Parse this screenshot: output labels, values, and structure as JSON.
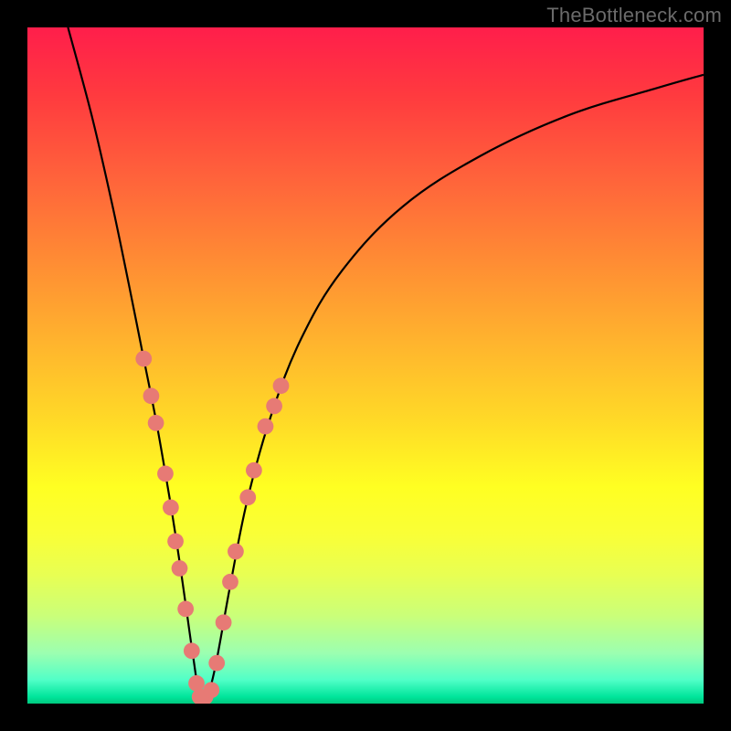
{
  "watermark": "TheBottleneck.com",
  "chart_data": {
    "type": "line",
    "title": "",
    "xlabel": "",
    "ylabel": "",
    "xlim": [
      0,
      1
    ],
    "ylim": [
      0,
      1
    ],
    "background_gradient": {
      "top": "#ff1e4b",
      "bottom": "#00c97e",
      "scale_meaning": "red = high bottleneck, green = low bottleneck"
    },
    "series": [
      {
        "name": "bottleneck-curve",
        "color": "#000000",
        "x": [
          0.06,
          0.095,
          0.125,
          0.15,
          0.17,
          0.19,
          0.205,
          0.215,
          0.225,
          0.235,
          0.245,
          0.255,
          0.265,
          0.278,
          0.3,
          0.325,
          0.36,
          0.405,
          0.465,
          0.555,
          0.67,
          0.8,
          0.93,
          1.0
        ],
        "values": [
          1.0,
          0.87,
          0.74,
          0.62,
          0.52,
          0.42,
          0.335,
          0.275,
          0.21,
          0.14,
          0.07,
          0.01,
          0.01,
          0.055,
          0.175,
          0.3,
          0.425,
          0.54,
          0.64,
          0.735,
          0.81,
          0.87,
          0.91,
          0.93
        ]
      }
    ],
    "markers": {
      "name": "highlighted-points",
      "color": "#e77a75",
      "radius_approx": 0.012,
      "points": [
        {
          "x": 0.172,
          "y": 0.51
        },
        {
          "x": 0.183,
          "y": 0.455
        },
        {
          "x": 0.19,
          "y": 0.415
        },
        {
          "x": 0.204,
          "y": 0.34
        },
        {
          "x": 0.212,
          "y": 0.29
        },
        {
          "x": 0.219,
          "y": 0.24
        },
        {
          "x": 0.225,
          "y": 0.2
        },
        {
          "x": 0.234,
          "y": 0.14
        },
        {
          "x": 0.243,
          "y": 0.078
        },
        {
          "x": 0.25,
          "y": 0.03
        },
        {
          "x": 0.255,
          "y": 0.01
        },
        {
          "x": 0.263,
          "y": 0.01
        },
        {
          "x": 0.272,
          "y": 0.02
        },
        {
          "x": 0.28,
          "y": 0.06
        },
        {
          "x": 0.29,
          "y": 0.12
        },
        {
          "x": 0.3,
          "y": 0.18
        },
        {
          "x": 0.308,
          "y": 0.225
        },
        {
          "x": 0.326,
          "y": 0.305
        },
        {
          "x": 0.335,
          "y": 0.345
        },
        {
          "x": 0.352,
          "y": 0.41
        },
        {
          "x": 0.365,
          "y": 0.44
        },
        {
          "x": 0.375,
          "y": 0.47
        }
      ]
    }
  }
}
